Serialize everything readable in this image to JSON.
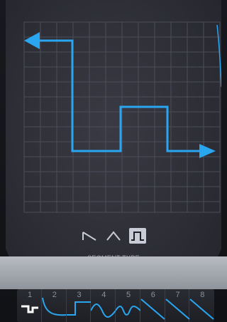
{
  "segment_types": {
    "label": "SEGMENT TYPE",
    "options": [
      {
        "name": "ramp-down",
        "icon": "ramp-down-icon",
        "selected": false
      },
      {
        "name": "triangle",
        "icon": "triangle-icon",
        "selected": false
      },
      {
        "name": "square",
        "icon": "square-pulse-icon",
        "selected": true
      }
    ]
  },
  "presets": {
    "slots": [
      {
        "number": "1",
        "icon": "square-step-icon",
        "active": true
      },
      {
        "number": "2",
        "icon": "decay-curve-icon",
        "active": false
      },
      {
        "number": "3",
        "icon": "pulse-icon",
        "active": false
      },
      {
        "number": "4",
        "icon": "wave-icon",
        "active": false
      },
      {
        "number": "5",
        "icon": "wave-icon",
        "active": false
      },
      {
        "number": "6",
        "icon": "saw-down-icon",
        "active": false
      },
      {
        "number": "7",
        "icon": "saw-down-icon",
        "active": false
      },
      {
        "number": "8",
        "icon": "saw-down-icon",
        "active": false
      }
    ]
  },
  "colors": {
    "accent": "#2aa6f0",
    "panel": "#2e2f37",
    "grid": "#4a4c58",
    "selected_bg": "#c9cbd6"
  }
}
